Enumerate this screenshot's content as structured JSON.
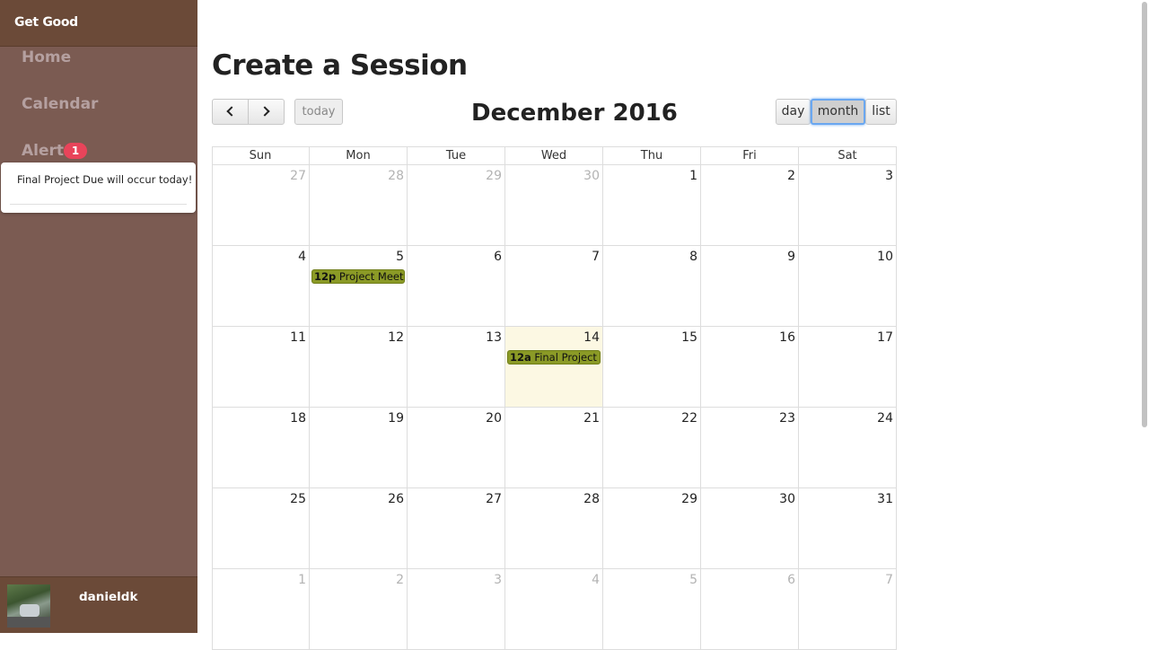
{
  "brand": "Get Good",
  "nav": {
    "home": "Home",
    "calendar": "Calendar",
    "alerts": "Alerts",
    "alert_count": "1"
  },
  "alert_popup": {
    "message": "Final Project Due will occur today!"
  },
  "user": {
    "name": "danieldk"
  },
  "page_title": "Create a Session",
  "toolbar": {
    "prev_icon": "chevron-left-icon",
    "next_icon": "chevron-right-icon",
    "today": "today",
    "title": "December 2016",
    "views": {
      "day": "day",
      "month": "month",
      "list": "list"
    },
    "active_view": "month"
  },
  "calendar": {
    "days_of_week": [
      "Sun",
      "Mon",
      "Tue",
      "Wed",
      "Thu",
      "Fri",
      "Sat"
    ],
    "weeks": [
      [
        {
          "d": "27",
          "o": true
        },
        {
          "d": "28",
          "o": true
        },
        {
          "d": "29",
          "o": true
        },
        {
          "d": "30",
          "o": true
        },
        {
          "d": "1"
        },
        {
          "d": "2"
        },
        {
          "d": "3"
        }
      ],
      [
        {
          "d": "4"
        },
        {
          "d": "5",
          "event": {
            "time": "12p",
            "title": "Project Meet up"
          }
        },
        {
          "d": "6"
        },
        {
          "d": "7"
        },
        {
          "d": "8"
        },
        {
          "d": "9"
        },
        {
          "d": "10"
        }
      ],
      [
        {
          "d": "11"
        },
        {
          "d": "12"
        },
        {
          "d": "13"
        },
        {
          "d": "14",
          "today": true,
          "event": {
            "time": "12a",
            "title": "Final Project Due"
          }
        },
        {
          "d": "15"
        },
        {
          "d": "16"
        },
        {
          "d": "17"
        }
      ],
      [
        {
          "d": "18"
        },
        {
          "d": "19"
        },
        {
          "d": "20"
        },
        {
          "d": "21"
        },
        {
          "d": "22"
        },
        {
          "d": "23"
        },
        {
          "d": "24"
        }
      ],
      [
        {
          "d": "25"
        },
        {
          "d": "26"
        },
        {
          "d": "27"
        },
        {
          "d": "28"
        },
        {
          "d": "29"
        },
        {
          "d": "30"
        },
        {
          "d": "31"
        }
      ],
      [
        {
          "d": "1",
          "o": true
        },
        {
          "d": "2",
          "o": true
        },
        {
          "d": "3",
          "o": true
        },
        {
          "d": "4",
          "o": true
        },
        {
          "d": "5",
          "o": true
        },
        {
          "d": "6",
          "o": true
        },
        {
          "d": "7",
          "o": true
        }
      ]
    ]
  },
  "colors": {
    "sidebar": "#7b5b52",
    "sidebar_header": "#6b4a38",
    "event": "#8b9a26",
    "today_highlight": "#fcf8e3",
    "badge": "#e8445a"
  }
}
